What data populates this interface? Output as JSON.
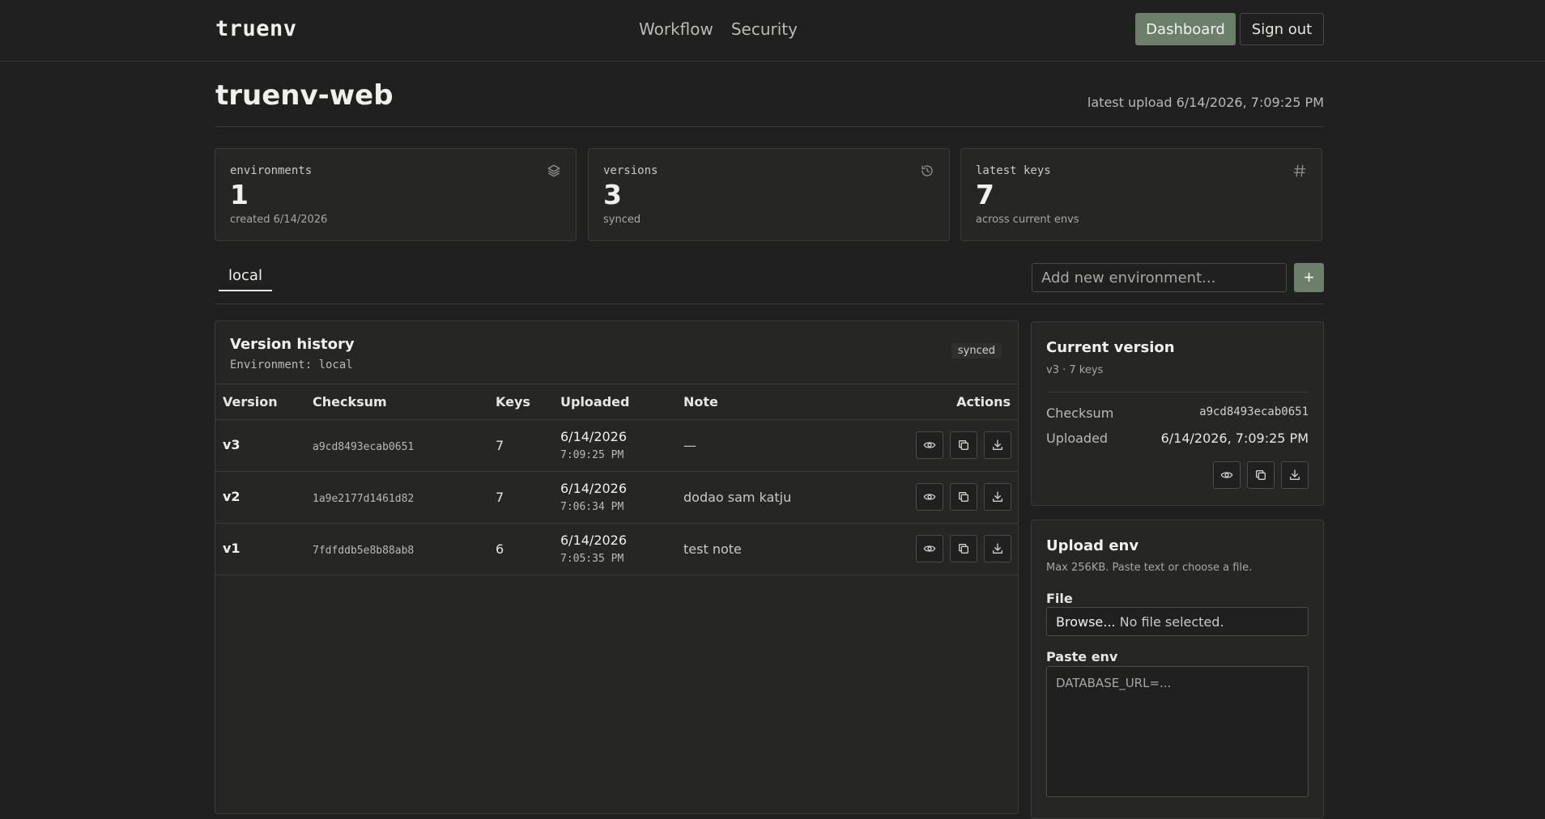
{
  "nav": {
    "brand": "truenv",
    "links": [
      "Workflow",
      "Security"
    ],
    "dashboard_label": "Dashboard",
    "signout_label": "Sign out"
  },
  "header": {
    "title": "truenv-web",
    "latest_upload": "latest upload 6/14/2026, 7:09:25 PM"
  },
  "stats": [
    {
      "label": "environments",
      "value": "1",
      "sub": "created 6/14/2026",
      "icon": "layers-icon"
    },
    {
      "label": "versions",
      "value": "3",
      "sub": "synced",
      "icon": "history-icon"
    },
    {
      "label": "latest keys",
      "value": "7",
      "sub": "across current envs",
      "icon": "hash-icon"
    }
  ],
  "env_tabs": {
    "active": "local",
    "add_placeholder": "Add new environment...",
    "add_label": "+"
  },
  "version_history": {
    "title": "Version history",
    "environment": "Environment: local",
    "badge": "synced",
    "columns": [
      "Version",
      "Checksum",
      "Keys",
      "Uploaded",
      "Note",
      "Actions"
    ],
    "rows": [
      {
        "version": "v3",
        "checksum": "a9cd8493ecab0651",
        "keys": "7",
        "date": "6/14/2026",
        "time": "7:09:25 PM",
        "note": "—"
      },
      {
        "version": "v2",
        "checksum": "1a9e2177d1461d82",
        "keys": "7",
        "date": "6/14/2026",
        "time": "7:06:34 PM",
        "note": "dodao sam katju"
      },
      {
        "version": "v1",
        "checksum": "7fdfddb5e8b88ab8",
        "keys": "6",
        "date": "6/14/2026",
        "time": "7:05:35 PM",
        "note": "test note"
      }
    ]
  },
  "current_version": {
    "title": "Current version",
    "sub": "v3 · 7 keys",
    "checksum_label": "Checksum",
    "checksum": "a9cd8493ecab0651",
    "uploaded_label": "Uploaded",
    "uploaded": "6/14/2026, 7:09:25 PM"
  },
  "upload": {
    "title": "Upload env",
    "sub": "Max 256KB. Paste text or choose a file.",
    "file_label": "File",
    "browse_label": "Browse...",
    "no_file": "No file selected.",
    "paste_label": "Paste env",
    "paste_placeholder": "DATABASE_URL=..."
  },
  "colors": {
    "background": "#1f201f",
    "panel": "#262725",
    "accent": "#6c7f6b",
    "border": "#3a3b39"
  }
}
